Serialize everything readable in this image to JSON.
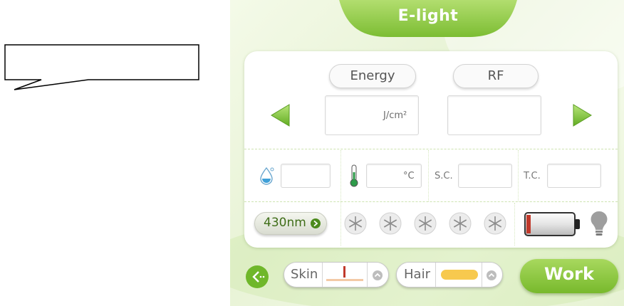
{
  "mode_title": "E-light",
  "params": {
    "energy_label": "Energy",
    "rf_label": "RF",
    "energy_unit": "J/cm²",
    "temp_unit": "°C",
    "sc_label": "S.C.",
    "tc_label": "T.C."
  },
  "wavelength_button": "430nm",
  "cooling_levels": 5,
  "bottom_bar": {
    "skin_label": "Skin",
    "hair_label": "Hair",
    "work_label": "Work"
  },
  "colors": {
    "accent_green": "#78b92c",
    "title_green": "#8cc63f",
    "hair_swatch": "#f7c94e",
    "battery_cap": "#c0392b",
    "thermometer": "#2e9b4a",
    "water_drop": "#4aa8d8"
  },
  "icons": [
    "speech-bubble",
    "left-arrow-icon",
    "right-arrow-icon",
    "water-drop-icon",
    "thermometer-icon",
    "snowflake-icon",
    "battery-icon",
    "lightbulb-icon",
    "back-icon",
    "up-chevron-icon"
  ]
}
